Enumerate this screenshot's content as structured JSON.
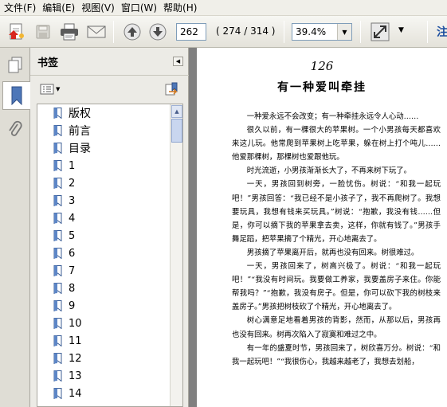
{
  "menu": [
    "文件(F)",
    "编辑(E)",
    "视图(V)",
    "窗口(W)",
    "帮助(H)"
  ],
  "toolbar": {
    "page_current": "262",
    "page_count": "( 274 / 314 )",
    "zoom": "39.4%",
    "cut_text": "注"
  },
  "icons": {
    "pages": "pages-icon",
    "bookmarks": "bookmark-panel-icon",
    "attachments": "paperclip-icon"
  },
  "bookmarks": {
    "title": "书签",
    "items": [
      "版权",
      "前言",
      "目录",
      "1",
      "2",
      "3",
      "4",
      "5",
      "6",
      "7",
      "8",
      "9",
      "10",
      "11",
      "12",
      "13",
      "14"
    ]
  },
  "document": {
    "page_number": "126",
    "title": "有一种爱叫牵挂",
    "paragraphs": [
      "一种爱永远不会改变；有一种牵挂永远令人心动……",
      "很久以前，有一棵很大的苹果树。一个小男孩每天都喜欢来这儿玩。他常爬到苹果树上吃苹果，躲在树上打个吨儿……他爱那棵树，那棵树也爱跟他玩。",
      "时光流逝，小男孩渐渐长大了，不再来树下玩了。",
      "一天，男孩回到树旁，一脸忧伤。树说：“和我一起玩吧！”男孩回答：“我已经不是小孩子了，我不再爬树了。我想要玩具，我想有钱来买玩具。”树说：“抱歉，我没有钱……但是，你可以摘下我的苹果拿去卖，这样，你就有钱了。”男孩手舞足蹈，把苹果摘了个精光，开心地离去了。",
      "男孩摘了苹果离开后，就再也没有回来。树很难过。",
      "一天，男孩回来了，树高兴极了。树说：“和我一起玩吧！”“我没有时间玩。我要做工养家，我要盖房子来住。你能帮我吗？”“抱歉，我没有房子。但是，你可以砍下我的树枝来盖房子。”男孩把树枝砍了个精光，开心地离去了。",
      "树心满意足地看着男孩的背影，然而，从那以后，男孩再也没有回来。树再次陷入了寂寞和难过之中。",
      "有一年的盛夏时节，男孩回来了，树欣喜万分。树说：“和我一起玩吧！”“我很伤心，我越来越老了，我想去划船，"
    ]
  }
}
